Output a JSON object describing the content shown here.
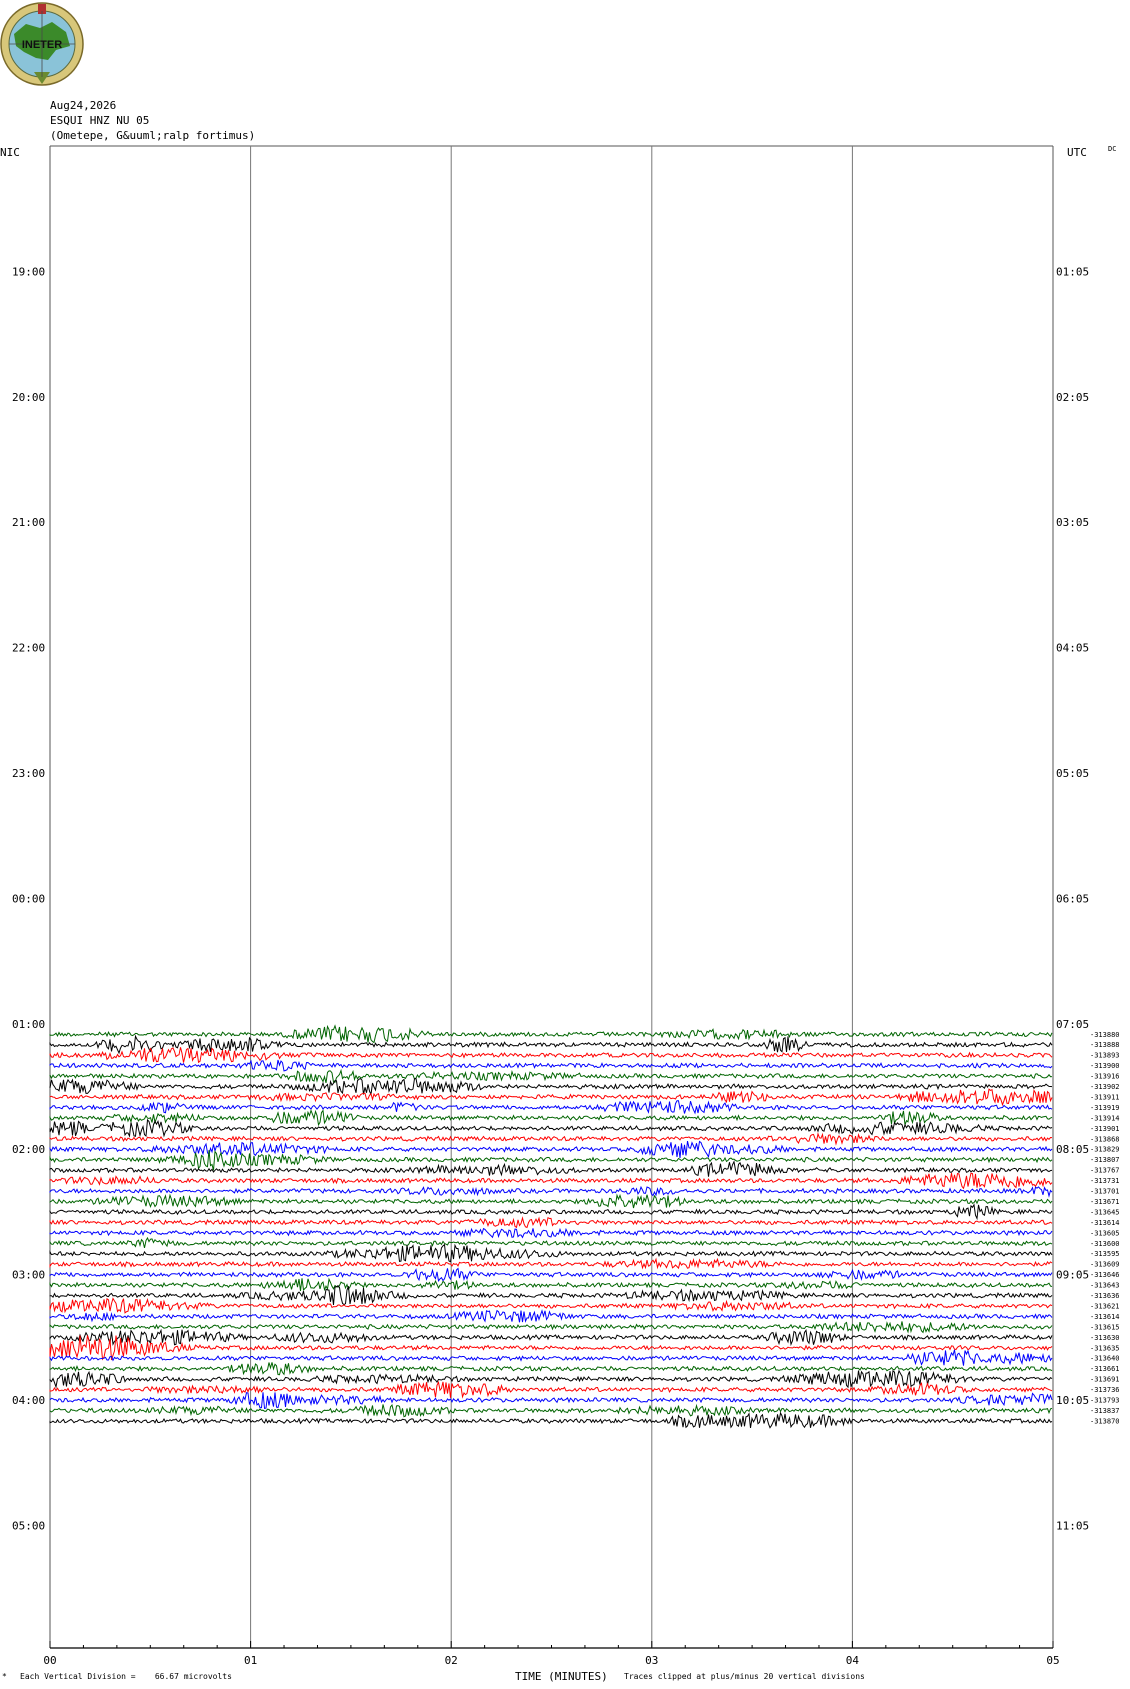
{
  "logo": {
    "text": "INETER",
    "colors": {
      "globe": "#8ac3d8",
      "land": "#3b8a2a",
      "ring": "#c9b868"
    }
  },
  "header": {
    "date": "Aug24,2026",
    "station": "ESQUI HNZ NU 05",
    "location": "(Ometepe, G&uuml;ralp fortimus)"
  },
  "axes": {
    "left_label": "NIC",
    "right_label": "UTC",
    "dc_label": "DC"
  },
  "footer": {
    "scale_note": "Each Vertical Division =    66.67 microvolts",
    "xlabel": "TIME (MINUTES)",
    "clip_note": "Traces clipped at plus/minus 20 vertical divisions"
  },
  "chart_data": {
    "type": "line",
    "title": "ESQUI HNZ NU 05",
    "xlabel": "TIME (MINUTES)",
    "x_ticks": [
      "00",
      "01",
      "02",
      "03",
      "04",
      "05"
    ],
    "xlim": [
      0,
      5
    ],
    "left_hour_labels": [
      "19:00",
      "20:00",
      "21:00",
      "22:00",
      "23:00",
      "00:00",
      "01:00",
      "02:00",
      "03:00",
      "04:00",
      "05:00"
    ],
    "right_hour_labels": [
      "01:05",
      "02:05",
      "03:05",
      "04:05",
      "05:05",
      "06:05",
      "07:05",
      "08:05",
      "09:05",
      "10:05",
      "11:05"
    ],
    "rows_per_hour": 12,
    "first_trace_row": 85,
    "trace_colors": [
      "#006400",
      "#000000",
      "#ff0000",
      "#0000ff"
    ],
    "trace_offsets": [
      -313880,
      -313888,
      -313893,
      -313900,
      -313916,
      -313902,
      -313911,
      -313919,
      -313914,
      -313901,
      -313868,
      -313829,
      -313807,
      -313767,
      -313731,
      -313701,
      -313671,
      -313645,
      -313614,
      -313605,
      -313600,
      -313595,
      -313609,
      -313646,
      -313643,
      -313636,
      -313621,
      -313614,
      -313615,
      -313630,
      -313635,
      -313640,
      -313661,
      -313691,
      -313736,
      -313793,
      -313837,
      -313870
    ]
  }
}
